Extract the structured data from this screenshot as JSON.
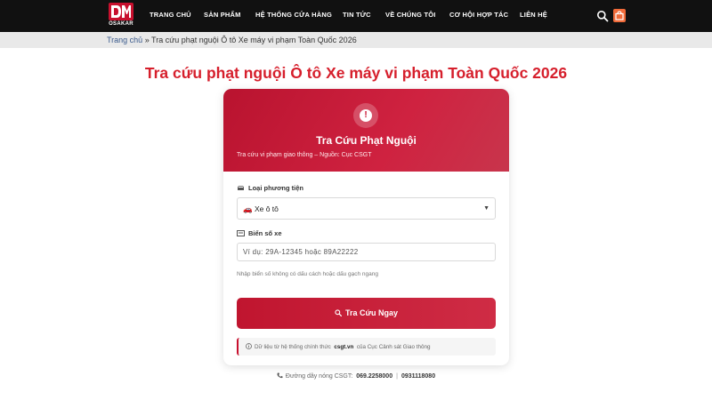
{
  "brand": {
    "name": "OSAKAR",
    "accent": "#c8102e"
  },
  "nav": {
    "items": [
      {
        "label": "TRANG CHỦ",
        "name": "nav-item-home"
      },
      {
        "label": "SẢN PHẨM",
        "name": "nav-item-products"
      },
      {
        "label": "HỆ THỐNG CỬA HÀNG",
        "name": "nav-item-stores"
      },
      {
        "label": "TIN TỨC",
        "name": "nav-item-news"
      },
      {
        "label": "VỀ CHÚNG TÔI",
        "name": "nav-item-about"
      },
      {
        "label": "CƠ HỘI HỢP TÁC",
        "name": "nav-item-partnership"
      },
      {
        "label": "LIÊN HỆ",
        "name": "nav-item-contact"
      }
    ],
    "search_icon": "search-icon",
    "cart_icon": "shopping-bag-icon"
  },
  "breadcrumb": {
    "home": "Trang chủ",
    "separator": " » ",
    "current": "Tra cứu phạt nguội Ô tô Xe máy vi phạm Toàn Quốc 2026"
  },
  "page_title": "Tra cứu phạt nguội Ô tô Xe máy vi phạm Toàn Quốc 2026",
  "card": {
    "icon": "alert-circle-icon",
    "title": "Tra Cứu Phạt Nguội",
    "subtitle": "Tra cứu vi phạm giao thông – Nguồn: Cục CSGT",
    "vehicle_label": "Loại phương tiện",
    "vehicle_value": "🚗 Xe ô tô",
    "plate_label": "Biển số xe",
    "plate_placeholder": "Ví dụ: 29A-12345 hoặc 89A22222",
    "hint": "Nhập biển số không có dấu cách hoặc dấu gạch ngang",
    "submit_label": "Tra Cứu Ngay",
    "source_prefix": "Dữ liệu từ hệ thống chính thức",
    "source_site": "csgt.vn",
    "source_suffix": "của Cục Cảnh sát Giao thông"
  },
  "hotline": {
    "label": "Đường dây nóng CSGT:",
    "number_1": "069.2258000",
    "divider": "|",
    "number_2": "0931118080"
  }
}
